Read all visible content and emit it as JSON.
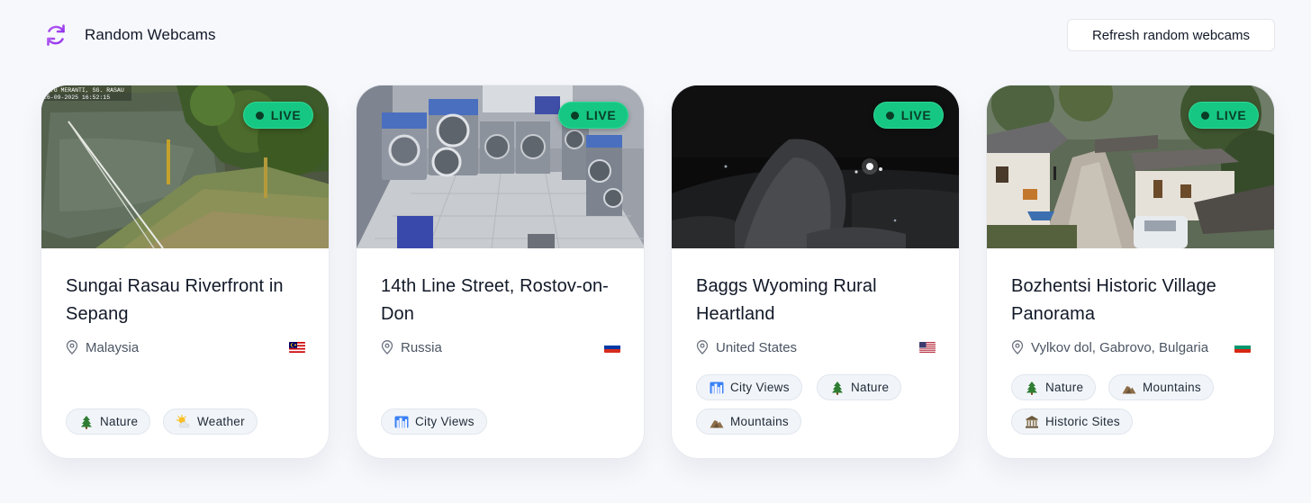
{
  "app": {
    "title": "Random Webcams",
    "logo_icon": "refresh-cycle-icon",
    "refresh_label": "Refresh random webcams",
    "accent_color": "#a855f7"
  },
  "live_label": "LIVE",
  "live_color": "#16c784",
  "webcams": [
    {
      "title": "Sungai Rasau Riverfront in Sepang",
      "location": "Malaysia",
      "flag": "malaysia-flag-icon",
      "tags": [
        {
          "label": "Nature",
          "icon": "evergreen-tree-icon"
        },
        {
          "label": "Weather",
          "icon": "sun-behind-cloud-icon"
        }
      ],
      "overlay_text": [
        "...G MERANTI, SG. RASAU",
        "26-09-2025 16:52:15"
      ]
    },
    {
      "title": "14th Line Street, Rostov-on-Don",
      "location": "Russia",
      "flag": "russia-flag-icon",
      "tags": [
        {
          "label": "City Views",
          "icon": "cityscape-icon"
        }
      ]
    },
    {
      "title": "Baggs Wyoming Rural Heartland",
      "location": "United States",
      "flag": "usa-flag-icon",
      "tags": [
        {
          "label": "City Views",
          "icon": "cityscape-icon"
        },
        {
          "label": "Nature",
          "icon": "evergreen-tree-icon"
        },
        {
          "label": "Mountains",
          "icon": "mountain-icon"
        }
      ]
    },
    {
      "title": "Bozhentsi Historic Village Panorama",
      "location": "Vylkov dol, Gabrovo, Bulgaria",
      "flag": "bulgaria-flag-icon",
      "tags": [
        {
          "label": "Nature",
          "icon": "evergreen-tree-icon"
        },
        {
          "label": "Mountains",
          "icon": "mountain-icon"
        },
        {
          "label": "Historic Sites",
          "icon": "classical-building-icon"
        }
      ]
    }
  ]
}
